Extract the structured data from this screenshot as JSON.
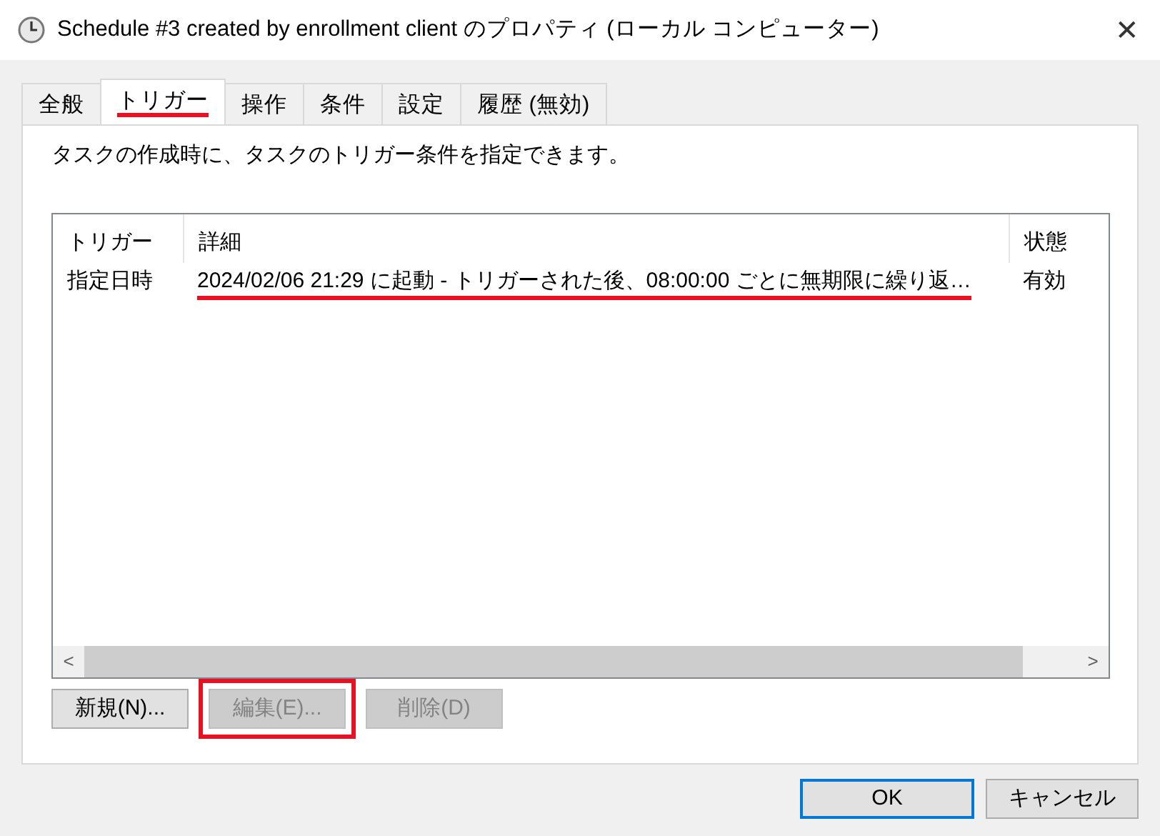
{
  "window": {
    "title": "Schedule #3 created by enrollment client のプロパティ (ローカル コンピューター)",
    "close": "✕"
  },
  "tabs": [
    {
      "label": "全般",
      "selected": false,
      "highlighted": false
    },
    {
      "label": "トリガー",
      "selected": true,
      "highlighted": true
    },
    {
      "label": "操作",
      "selected": false,
      "highlighted": false
    },
    {
      "label": "条件",
      "selected": false,
      "highlighted": false
    },
    {
      "label": "設定",
      "selected": false,
      "highlighted": false
    },
    {
      "label": "履歴 (無効)",
      "selected": false,
      "highlighted": false
    }
  ],
  "description": "タスクの作成時に、タスクのトリガー条件を指定できます。",
  "table": {
    "columns": [
      "トリガー",
      "詳細",
      "状態"
    ],
    "rows": [
      {
        "cells": [
          "指定日時",
          "2024/02/06 21:29 に起動 - トリガーされた後、08:00:00 ごとに無期限に繰り返…",
          "有効"
        ],
        "highlighted": true
      }
    ],
    "scroll_left": "<",
    "scroll_right": ">"
  },
  "buttons": [
    {
      "label": "新規(N)...",
      "disabled": false,
      "highlighted": false
    },
    {
      "label": "編集(E)...",
      "disabled": true,
      "highlighted": true
    },
    {
      "label": "削除(D)",
      "disabled": true,
      "highlighted": false
    }
  ],
  "footer_buttons": [
    {
      "label": "OK",
      "default": true
    },
    {
      "label": "キャンセル",
      "default": false
    }
  ]
}
